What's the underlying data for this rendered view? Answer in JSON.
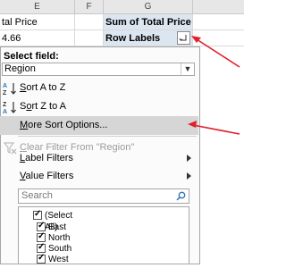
{
  "sheet": {
    "columns": [
      "E",
      "F",
      "G"
    ],
    "e1": "tal Price",
    "e2": "4.66",
    "g1": "Sum of Total Price",
    "g2": "Row Labels"
  },
  "dropdown": {
    "select_field_label": "Select field:",
    "selected_field": "Region",
    "menu": [
      {
        "label": "Sort A to Z",
        "key": "S",
        "icon": "sort-a-to-z-icon"
      },
      {
        "label": "Sort Z to A",
        "key": "o",
        "icon": "sort-z-to-a-icon"
      },
      {
        "label": "More Sort Options...",
        "key": "M",
        "highlighted": true
      },
      {
        "label": "Clear Filter From \"Region\"",
        "key": "C",
        "disabled": true,
        "icon": "clear-filter-icon"
      },
      {
        "label": "Label Filters",
        "key": "L",
        "submenu": true
      },
      {
        "label": "Value Filters",
        "key": "V",
        "submenu": true
      }
    ],
    "search_placeholder": "Search",
    "checklist": [
      {
        "label": "(Select All)",
        "checked": true
      },
      {
        "label": "East",
        "checked": true
      },
      {
        "label": "North",
        "checked": true
      },
      {
        "label": "South",
        "checked": true
      },
      {
        "label": "West",
        "checked": true
      }
    ]
  },
  "colors": {
    "pivot_header": "#dce6f1",
    "highlight": "#d6d6d6",
    "annotation_arrow": "#e0202a",
    "sort_icon_blue": "#2e75b6"
  }
}
